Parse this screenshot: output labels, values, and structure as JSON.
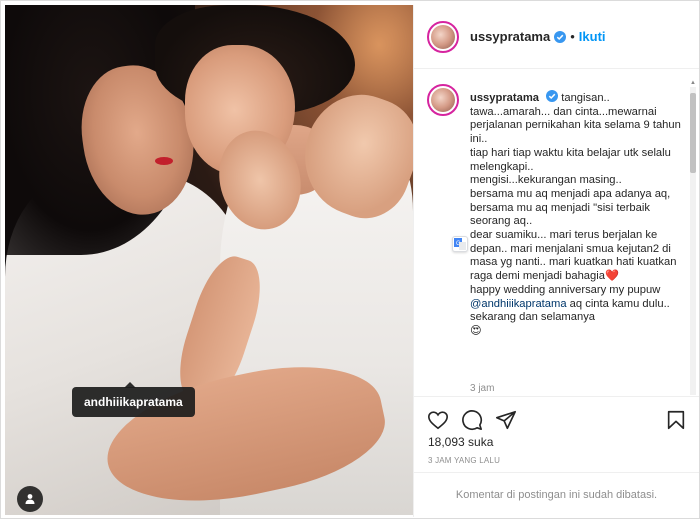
{
  "post": {
    "image_tag_username": "andhiiikapratama"
  },
  "header": {
    "username": "ussypratama",
    "separator": "•",
    "follow_label": "Ikuti"
  },
  "caption": {
    "username": "ussypratama",
    "text_before_mention": "tangisan.. tawa...amarah... dan cinta...mewarnai perjalanan pernikahan kita selama 9 tahun ini..\ntiap hari tiap waktu kita belajar utk selalu melengkapi..\nmengisi...kekurangan masing..\nbersama mu aq menjadi apa adanya aq, bersama mu aq menjadi \"sisi terbaik seorang aq..\ndear suamiku... mari terus berjalan ke depan.. mari menjalani smua kejutan2 di masa yg nanti.. mari kuatkan hati kuatkan raga demi menjadi bahagia❤️\nhappy wedding anniversary my pupuw ",
    "mention": "@andhiiikapratama",
    "text_after_mention": " aq cinta kamu dulu.. sekarang dan selamanya\n😍",
    "time": "3 jam"
  },
  "engagement": {
    "likes_text": "18,093 suka",
    "posted_ago": "3 JAM YANG LALU"
  },
  "comments": {
    "disabled_text": "Komentar di postingan ini sudah dibatasi."
  },
  "colors": {
    "accent_blue": "#0095f6",
    "mention_blue": "#00376b",
    "muted_gray": "#8e8e8e",
    "heart_red": "#ed4956"
  },
  "icons": [
    "verified-badge-icon",
    "heart-icon",
    "comment-icon",
    "share-icon",
    "bookmark-icon",
    "user-tag-icon",
    "translate-icon"
  ]
}
